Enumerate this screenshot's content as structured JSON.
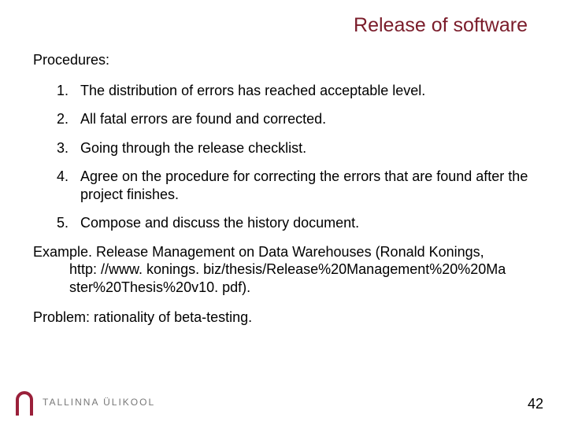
{
  "title": "Release of software",
  "procedures_label": "Procedures:",
  "items": [
    {
      "n": "1.",
      "t": "The distribution of errors has reached acceptable level."
    },
    {
      "n": "2.",
      "t": "All fatal errors are found and corrected."
    },
    {
      "n": "3.",
      "t": "Going through the release checklist."
    },
    {
      "n": "4.",
      "t": "Agree on the procedure for correcting the errors that are found after the project finishes."
    },
    {
      "n": "5.",
      "t": "Compose and discuss the history document."
    }
  ],
  "example_lead": "Example. Release Management on Data Warehouses (Ronald Konings,",
  "example_url1": "http: //www. konings. biz/thesis/Release%20Management%20%20Ma",
  "example_url2": "ster%20Thesis%20v10. pdf).",
  "problem": "Problem: rationality of beta-testing.",
  "logo_text": "TALLINNA ÜLIKOOL",
  "page_number": "42",
  "colors": {
    "title": "#7a1c2a",
    "logo": "#9a203a"
  }
}
